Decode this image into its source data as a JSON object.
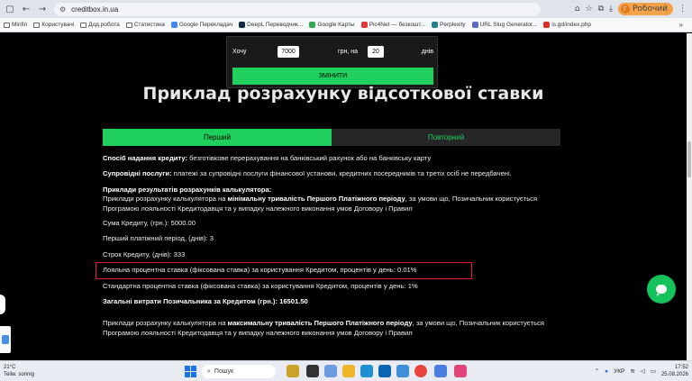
{
  "browser": {
    "url": "creditbox.in.ua",
    "profile_label": "Робочий",
    "profile_initial": "Г"
  },
  "bookmarks": [
    {
      "label": "Minfin",
      "color": ""
    },
    {
      "label": "Користувачі",
      "color": ""
    },
    {
      "label": "Дод.робота",
      "color": ""
    },
    {
      "label": "Статистика",
      "color": ""
    },
    {
      "label": "Google Перекладач",
      "color": "#4285f4"
    },
    {
      "label": "DeepL Переводчик...",
      "color": "#0f2b46"
    },
    {
      "label": "Google Карты",
      "color": "#34a853"
    },
    {
      "label": "Pic4Net — безкошт...",
      "color": "#e53935"
    },
    {
      "label": "Perplexity",
      "color": "#20808d"
    },
    {
      "label": "URL Slug Generator...",
      "color": "#5c6bc0"
    },
    {
      "label": "is.gd/index.php",
      "color": "#d93025"
    }
  ],
  "calculator": {
    "want_label": "Хочу",
    "amount": "7000",
    "currency_label": "грн, на",
    "days": "20",
    "days_label": "днів",
    "button_label": "ЗМІНИТИ"
  },
  "heading": "Приклад розрахунку відсоткової ставки",
  "tabs": [
    "Перший",
    "Повторний"
  ],
  "content": {
    "method_label": "Спосіб надання кредиту:",
    "method_text": " безготівкове перерахування на банківський рахунок або на банківську карту",
    "services_label": "Супровідні послуги:",
    "services_text": " платежі за супровідні послуги фінансової установи, кредитних посередників та третіх осіб не передбачені.",
    "examples_label": "Приклади результатів розрахунків калькулятора:",
    "ex1_pre": "Приклади розрахунку калькулятора на ",
    "ex1_bold": "мінімальну тривалість Першого Платіжного періоду",
    "ex1_post": ", за умови що, Позичальник користується Програмою лояльності Кредитодавця та у випадку належного виконання умов Договору і Правил",
    "amount_line": "Сума Кредиту, (грн.): 5000.00",
    "first_period_line": "Перший платіжний період, (днів): 3",
    "term_line": "Строк Кредиту, (днів): 333",
    "loyal_rate_line": "Лояльна процентна ставка (фіксована ставка) за користування Кредитом, процентів у день: 0.01%",
    "standard_rate_line": "Стандартна процентна ставка (фіксована ставка) за користування Кредитом, процентів у день: 1%",
    "total_cost_line": "Загальні витрати Позичальника за Кредитом (грн.): 16501.50",
    "ex2_pre": "Приклади розрахунку калькулятора на ",
    "ex2_bold": "максимальну тривалість Першого Платіжного періоду",
    "ex2_post": ", за умови що, Позичальник користується Програмою лояльності Кредитодавця та у випадку належного виконання умов Договору і Правил"
  },
  "taskbar": {
    "temperature": "21°C",
    "weather": "Teilw. sonnig",
    "search_placeholder": "Пошук",
    "lang": "УКР",
    "time": "17:52",
    "date": "25.08.2026"
  }
}
